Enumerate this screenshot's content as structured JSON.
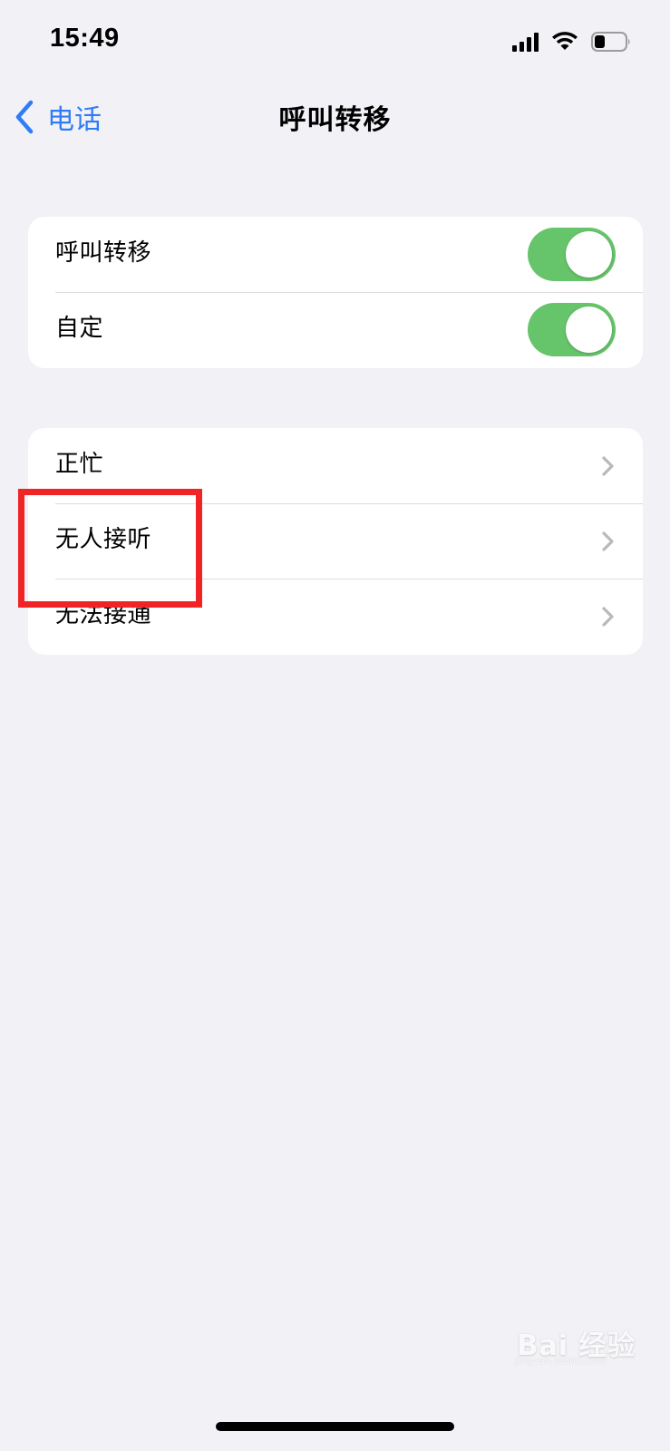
{
  "status_bar": {
    "time": "15:49",
    "icons": [
      "signal-icon",
      "wifi-icon",
      "battery-icon"
    ],
    "battery_level": 0.25
  },
  "navigation": {
    "back_label": "电话",
    "title": "呼叫转移"
  },
  "sections": {
    "forwarding": [
      {
        "label": "呼叫转移",
        "enabled": true
      },
      {
        "label": "自定",
        "enabled": true
      }
    ],
    "conditions": [
      {
        "label": "正忙"
      },
      {
        "label": "无人接听"
      },
      {
        "label": "无法接通"
      }
    ]
  },
  "colors": {
    "background": "#F1F1F6",
    "card": "#FFFFFF",
    "accent": "#2F7CF6",
    "toggle_on": "#66C56B",
    "separator": "#DDDDE1",
    "chevron": "#B8B8BE",
    "highlight": "#F02424"
  },
  "watermark": {
    "text": "Bai 经验",
    "subtext": "jingyan.baidu.com"
  }
}
